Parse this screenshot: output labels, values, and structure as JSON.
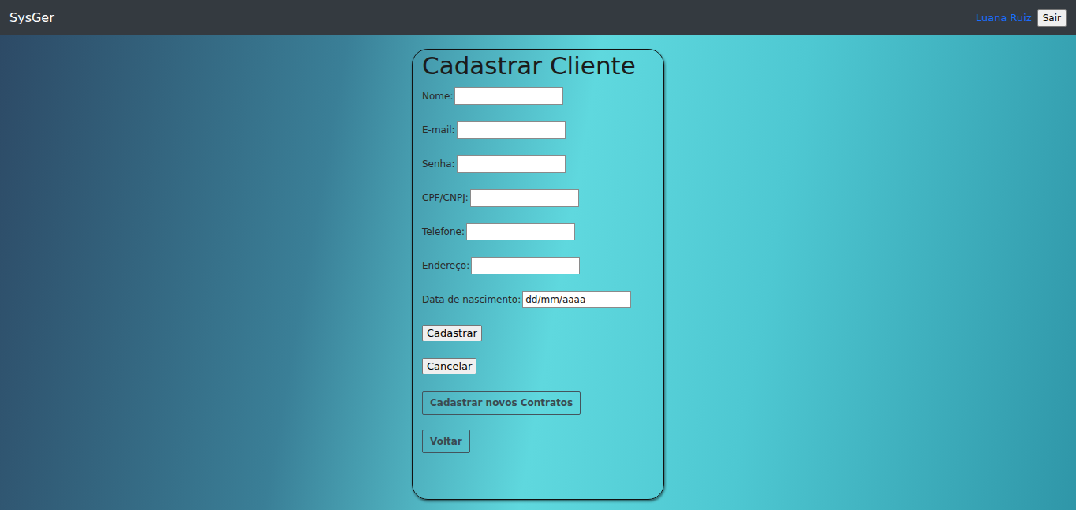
{
  "navbar": {
    "brand": "SysGer",
    "user": "Luana Ruiz",
    "logout": "Sair"
  },
  "form": {
    "title": "Cadastrar Cliente",
    "fields": [
      {
        "label": "Nome:",
        "placeholder": ""
      },
      {
        "label": "E-mail:",
        "placeholder": ""
      },
      {
        "label": "Senha:",
        "placeholder": ""
      },
      {
        "label": "CPF/CNPJ:",
        "placeholder": ""
      },
      {
        "label": "Telefone:",
        "placeholder": ""
      },
      {
        "label": "Endereço:",
        "placeholder": ""
      },
      {
        "label": "Data de nascimento:",
        "placeholder": "dd/mm/aaaa"
      }
    ],
    "buttons": [
      {
        "label": "Cadastrar",
        "disabled": false
      },
      {
        "label": "Cancelar",
        "disabled": false
      },
      {
        "label": "Cadastrar novos Contratos",
        "disabled": true
      },
      {
        "label": "Voltar",
        "disabled": true
      }
    ]
  }
}
